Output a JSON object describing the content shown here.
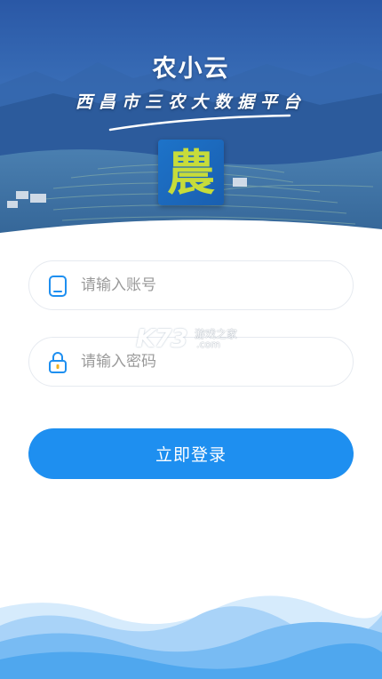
{
  "header": {
    "app_title": "农小云",
    "subtitle": "西昌市三农大数据平台",
    "logo_char": "農"
  },
  "form": {
    "account": {
      "placeholder": "请输入账号",
      "icon": "phone-icon"
    },
    "password": {
      "placeholder": "请输入密码",
      "icon": "lock-icon"
    },
    "login_label": "立即登录"
  },
  "watermark": {
    "brand": "K73",
    "cn": "游戏之家",
    "com": ".com"
  },
  "colors": {
    "primary": "#1e8ff0",
    "hero_blue": "#2f5ea8",
    "wave_light": "#bfe0fb",
    "wave_dark": "#4fa7ee"
  }
}
